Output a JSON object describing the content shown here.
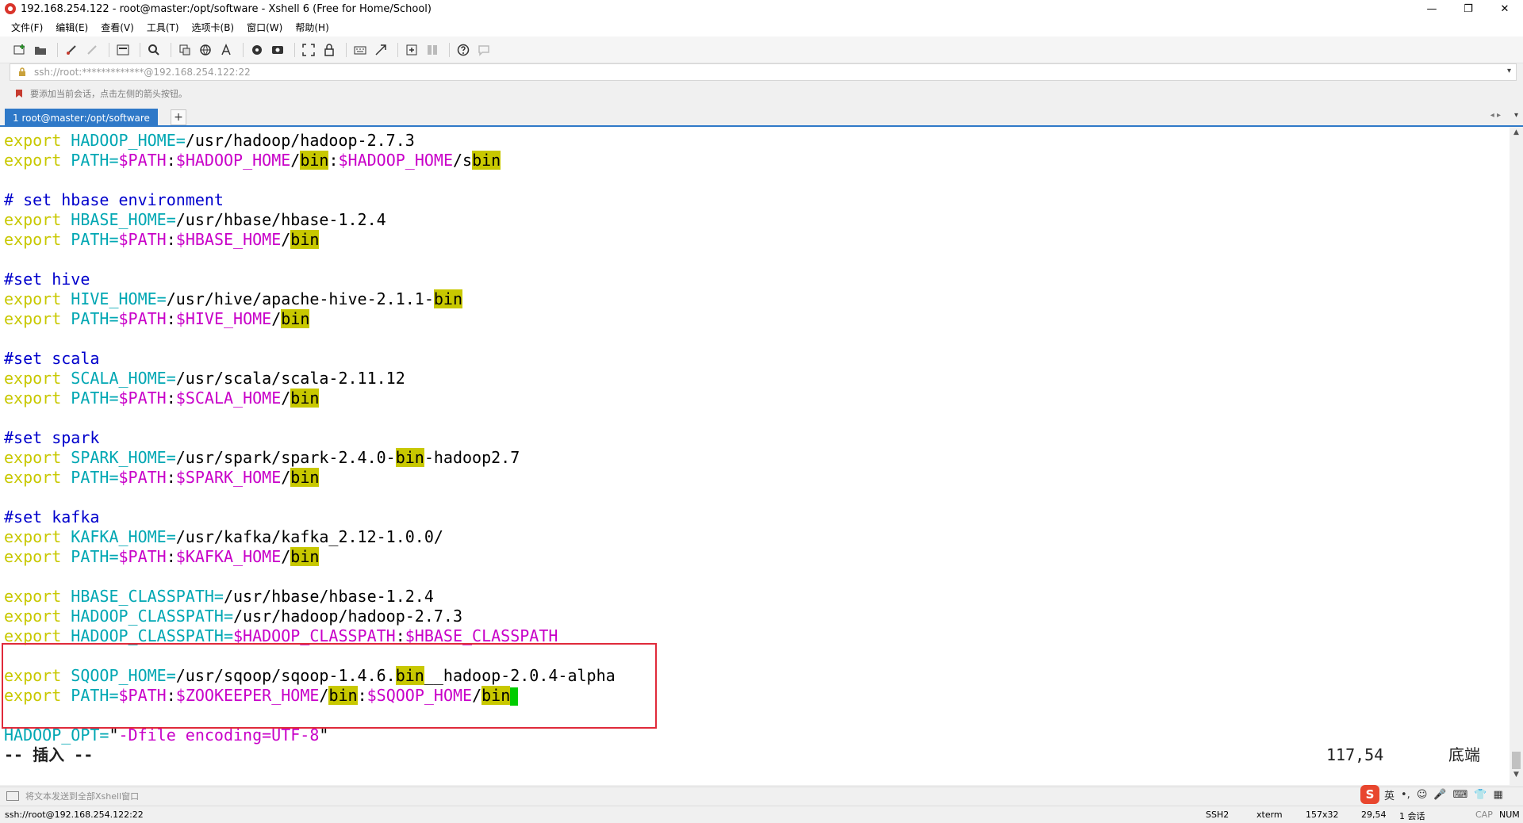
{
  "window": {
    "title": "192.168.254.122 - root@master:/opt/software - Xshell 6 (Free for Home/School)",
    "controls": {
      "minimize": "—",
      "restore": "❐",
      "close": "✕"
    }
  },
  "menu": [
    "文件(F)",
    "编辑(E)",
    "查看(V)",
    "工具(T)",
    "选项卡(B)",
    "窗口(W)",
    "帮助(H)"
  ],
  "address": {
    "text": "ssh://root:*************@192.168.254.122:22",
    "dropdown": "▾"
  },
  "hint": {
    "text": "要添加当前会话，点击左侧的箭头按钮。"
  },
  "tabs": [
    {
      "label": "1 root@master:/opt/software"
    }
  ],
  "tab_add": "+",
  "tab_nav": "◂ ▸",
  "tab_menu": "▾",
  "terminal": {
    "lines": [
      {
        "kw": "export",
        "var": "HADOOP_HOME=",
        "val": "/usr/hadoop/hadoop-2.7.3"
      },
      {
        "kw": "export",
        "var": "PATH=",
        "p1": "$PATH",
        "sep1": ":",
        "p2": "$HADOOP_HOME",
        "sl1": "/",
        "h1": "bin",
        "sep2": ":",
        "p3": "$HADOOP_HOME",
        "sl2": "/s",
        "h2": "bin"
      },
      {
        "cm": "# set hbase environment"
      },
      {
        "kw": "export",
        "var": "HBASE_HOME=",
        "val": "/usr/hbase/hbase-1.2.4"
      },
      {
        "kw": "export",
        "var": "PATH=",
        "p1": "$PATH",
        "sep1": ":",
        "p2": "$HBASE_HOME",
        "sl1": "/",
        "h1": "bin"
      },
      {
        "cm": "#set hive"
      },
      {
        "kw": "export",
        "var": "HIVE_HOME=",
        "val": "/usr/hive/apache-hive-2.1.1-",
        "h1": "bin"
      },
      {
        "kw": "export",
        "var": "PATH=",
        "p1": "$PATH",
        "sep1": ":",
        "p2": "$HIVE_HOME",
        "sl1": "/",
        "h1": "bin"
      },
      {
        "cm": "#set scala"
      },
      {
        "kw": "export",
        "var": "SCALA_HOME=",
        "val": "/usr/scala/scala-2.11.12"
      },
      {
        "kw": "export",
        "var": "PATH=",
        "p1": "$PATH",
        "sep1": ":",
        "p2": "$SCALA_HOME",
        "sl1": "/",
        "h1": "bin"
      },
      {
        "cm": "#set spark"
      },
      {
        "kw": "export",
        "var": "SPARK_HOME=",
        "val": "/usr/spark/spark-2.4.0-",
        "h1": "bin",
        "val2": "-hadoop2.7"
      },
      {
        "kw": "export",
        "var": "PATH=",
        "p1": "$PATH",
        "sep1": ":",
        "p2": "$SPARK_HOME",
        "sl1": "/",
        "h1": "bin"
      },
      {
        "cm": "#set kafka"
      },
      {
        "kw": "export",
        "var": "KAFKA_HOME=",
        "val": "/usr/kafka/kafka_2.12-1.0.0/"
      },
      {
        "kw": "export",
        "var": "PATH=",
        "p1": "$PATH",
        "sep1": ":",
        "p2": "$KAFKA_HOME",
        "sl1": "/",
        "h1": "bin"
      },
      {
        "kw": "export",
        "var": "HBASE_CLASSPATH=",
        "val": "/usr/hbase/hbase-1.2.4"
      },
      {
        "kw": "export",
        "var": "HADOOP_CLASSPATH=",
        "val": "/usr/hadoop/hadoop-2.7.3"
      },
      {
        "kw": "export",
        "var": "HADOOP_CLASSPATH=",
        "p1": "$HADOOP_CLASSPATH",
        "sep1": ":",
        "p2": "$HBASE_CLASSPATH"
      },
      {
        "kw": "export",
        "var": "SQOOP_HOME=",
        "val": "/usr/sqoop/sqoop-1.4.6.",
        "h1": "bin",
        "val2": "__hadoop-2.0.4-alpha"
      },
      {
        "kw": "export",
        "var": "PATH=",
        "p1": "$PATH",
        "sep1": ":",
        "p2": "$ZOOKEEPER_HOME",
        "sl1": "/",
        "h1": "bin",
        "sep2": ":",
        "p3": "$SQOOP_HOME",
        "sl2": "/",
        "h2": "bin"
      },
      {
        "var": "HADOOP_OPT=",
        "q": "\"",
        "pv": "-Dfile encoding=UTF-8",
        "q2": "\""
      }
    ],
    "mode": "-- 插入 --",
    "position": "117,54",
    "scroll_state": "底端"
  },
  "send_bar": {
    "text": "将文本发送到全部Xshell窗口"
  },
  "ime": {
    "logo": "S",
    "lang": "英"
  },
  "status": {
    "connection": "ssh://root@192.168.254.122:22",
    "protocol": "SSH2",
    "terminal_type": "xterm",
    "size": "157x32",
    "cursor": "29,54",
    "sessions": "1 会话",
    "cap": "CAP",
    "num": "NUM"
  }
}
